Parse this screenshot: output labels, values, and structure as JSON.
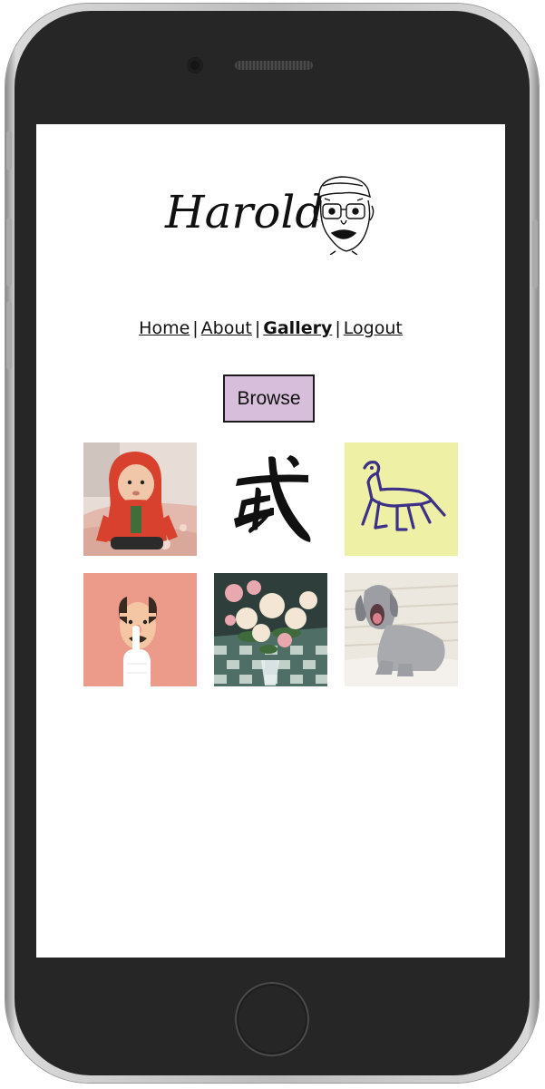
{
  "site": {
    "logo_text": "Harold"
  },
  "nav": {
    "items": [
      {
        "label": "Home",
        "active": false
      },
      {
        "label": "About",
        "active": false
      },
      {
        "label": "Gallery",
        "active": true
      },
      {
        "label": "Logout",
        "active": false
      }
    ],
    "separator": "|"
  },
  "browse_button": {
    "label": "Browse",
    "color": "#d7bedb"
  },
  "gallery": {
    "images": [
      {
        "name": "baby-in-red-hoodie-image"
      },
      {
        "name": "chinese-character-image"
      },
      {
        "name": "dinosaur-drawing-image"
      },
      {
        "name": "bald-man-cartoon-image"
      },
      {
        "name": "flowers-image"
      },
      {
        "name": "grey-puppy-image"
      }
    ]
  }
}
